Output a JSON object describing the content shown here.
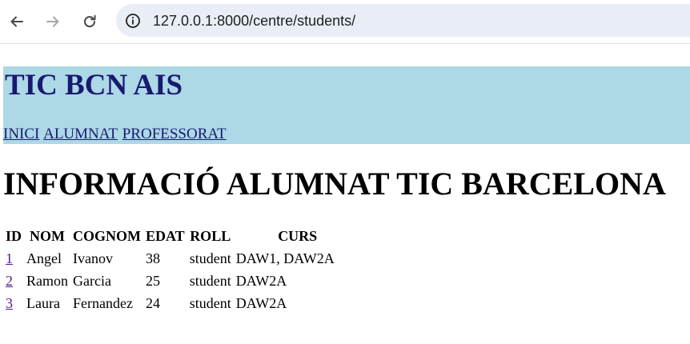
{
  "browser": {
    "url": "127.0.0.1:8000/centre/students/"
  },
  "header": {
    "title": "TIC BCN AIS",
    "nav": [
      {
        "label": "INICI"
      },
      {
        "label": "ALUMNAT"
      },
      {
        "label": "PROFESSORAT"
      }
    ]
  },
  "main": {
    "title": "INFORMACIÓ ALUMNAT TIC BARCELONA",
    "table": {
      "columns": [
        "ID",
        "NOM",
        "COGNOM",
        "EDAT",
        "ROLL",
        "CURS"
      ],
      "rows": [
        {
          "id": "1",
          "nom": "Angel",
          "cognom": "Ivanov",
          "edat": "38",
          "roll": "student",
          "curs": "DAW1, DAW2A"
        },
        {
          "id": "2",
          "nom": "Ramon",
          "cognom": "Garcia",
          "edat": "25",
          "roll": "student",
          "curs": "DAW2A"
        },
        {
          "id": "3",
          "nom": "Laura",
          "cognom": "Fernandez",
          "edat": "24",
          "roll": "student",
          "curs": "DAW2A"
        }
      ]
    }
  }
}
